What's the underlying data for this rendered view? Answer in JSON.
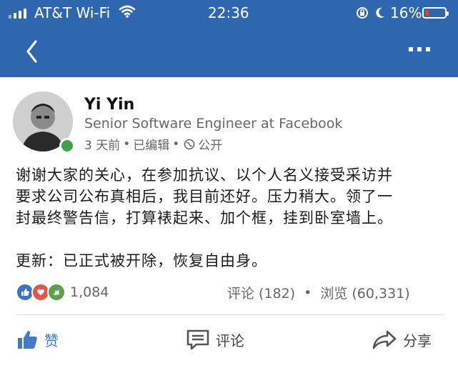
{
  "status_bar": {
    "carrier": "AT&T Wi-Fi",
    "time": "22:36",
    "battery": "16%"
  },
  "nav": {
    "back_icon": "chevron-left-icon",
    "more_icon": "more-icon"
  },
  "post": {
    "author": "Yi Yin",
    "headline": "Senior Software Engineer at Facebook",
    "time": "3 天前",
    "sep1": "•",
    "edited": "已编辑",
    "sep2": "•",
    "visibility": "公开",
    "body_lines": [
      "谢谢大家的关心，在参加抗议、以个人名义接受采访并",
      "要求公司公布真相后，我目前还好。压力稍大。领了一",
      "封最终警告信，打算裱起来、加个框，挂到卧室墙上。"
    ],
    "update": "更新：已正式被开除，恢复自由身。"
  },
  "social": {
    "reaction_count": "1,084",
    "comments": "评论 (182)",
    "dot": "•",
    "views": "浏览 (60,331)"
  },
  "actions": {
    "like": "赞",
    "comment": "评论",
    "share": "分享"
  },
  "colors": {
    "header": "#2e67b0",
    "like_blue": "#3f7bc8",
    "presence_green": "#3fa14a"
  }
}
